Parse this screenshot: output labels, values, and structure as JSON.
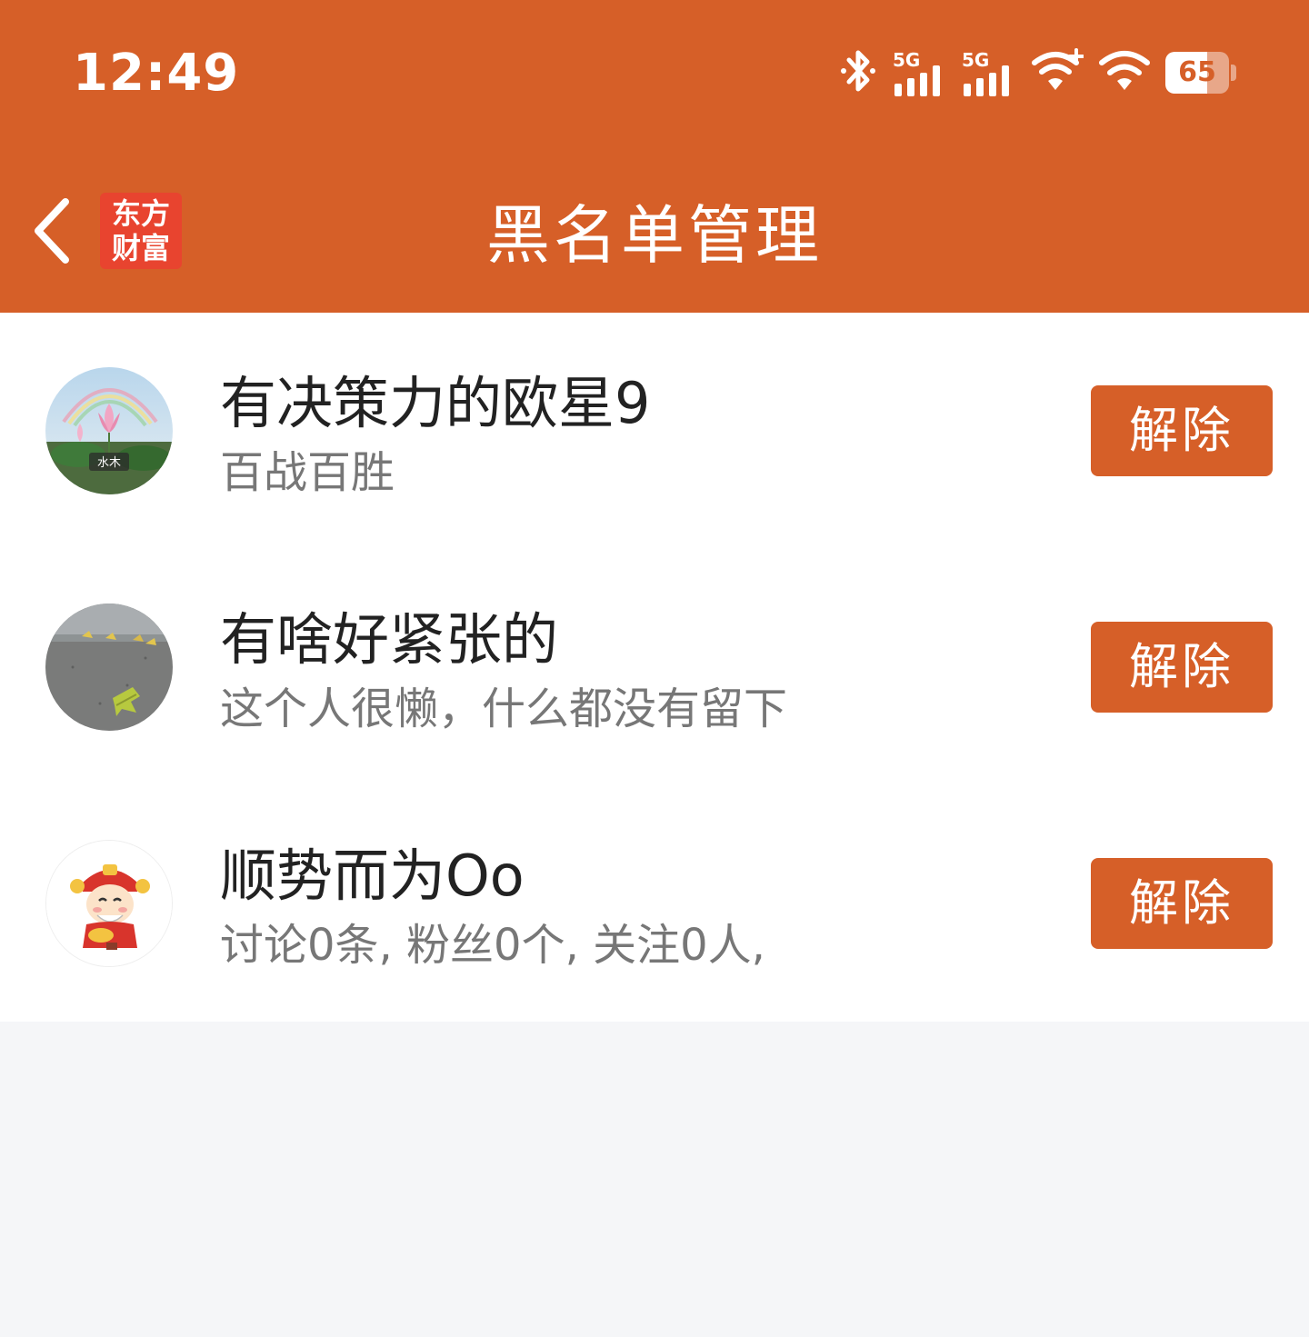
{
  "status_bar": {
    "time": "12:49",
    "network_1": "5G",
    "network_2": "5G",
    "battery_level": "65",
    "battery_fraction": 0.65
  },
  "nav": {
    "title": "黑名单管理",
    "logo_line1": "东方",
    "logo_line2": "财富"
  },
  "theme": {
    "accent": "#D65F28",
    "logo_red": "#E8442F",
    "background": "#F5F6F8"
  },
  "blacklist": [
    {
      "name": "有决策力的欧星9",
      "desc": "百战百胜",
      "button": "解除",
      "avatar_text": "水木"
    },
    {
      "name": "有啥好紧张的",
      "desc": "这个人很懒，什么都没有留下",
      "button": "解除"
    },
    {
      "name": "顺势而为Oo",
      "desc": "讨论0条, 粉丝0个, 关注0人,",
      "button": "解除"
    }
  ],
  "icons": {
    "back": "chevron-left-icon",
    "bluetooth": "bluetooth-icon",
    "signal": "cellular-signal-icon",
    "wifi": "wifi-icon",
    "battery": "battery-icon"
  }
}
